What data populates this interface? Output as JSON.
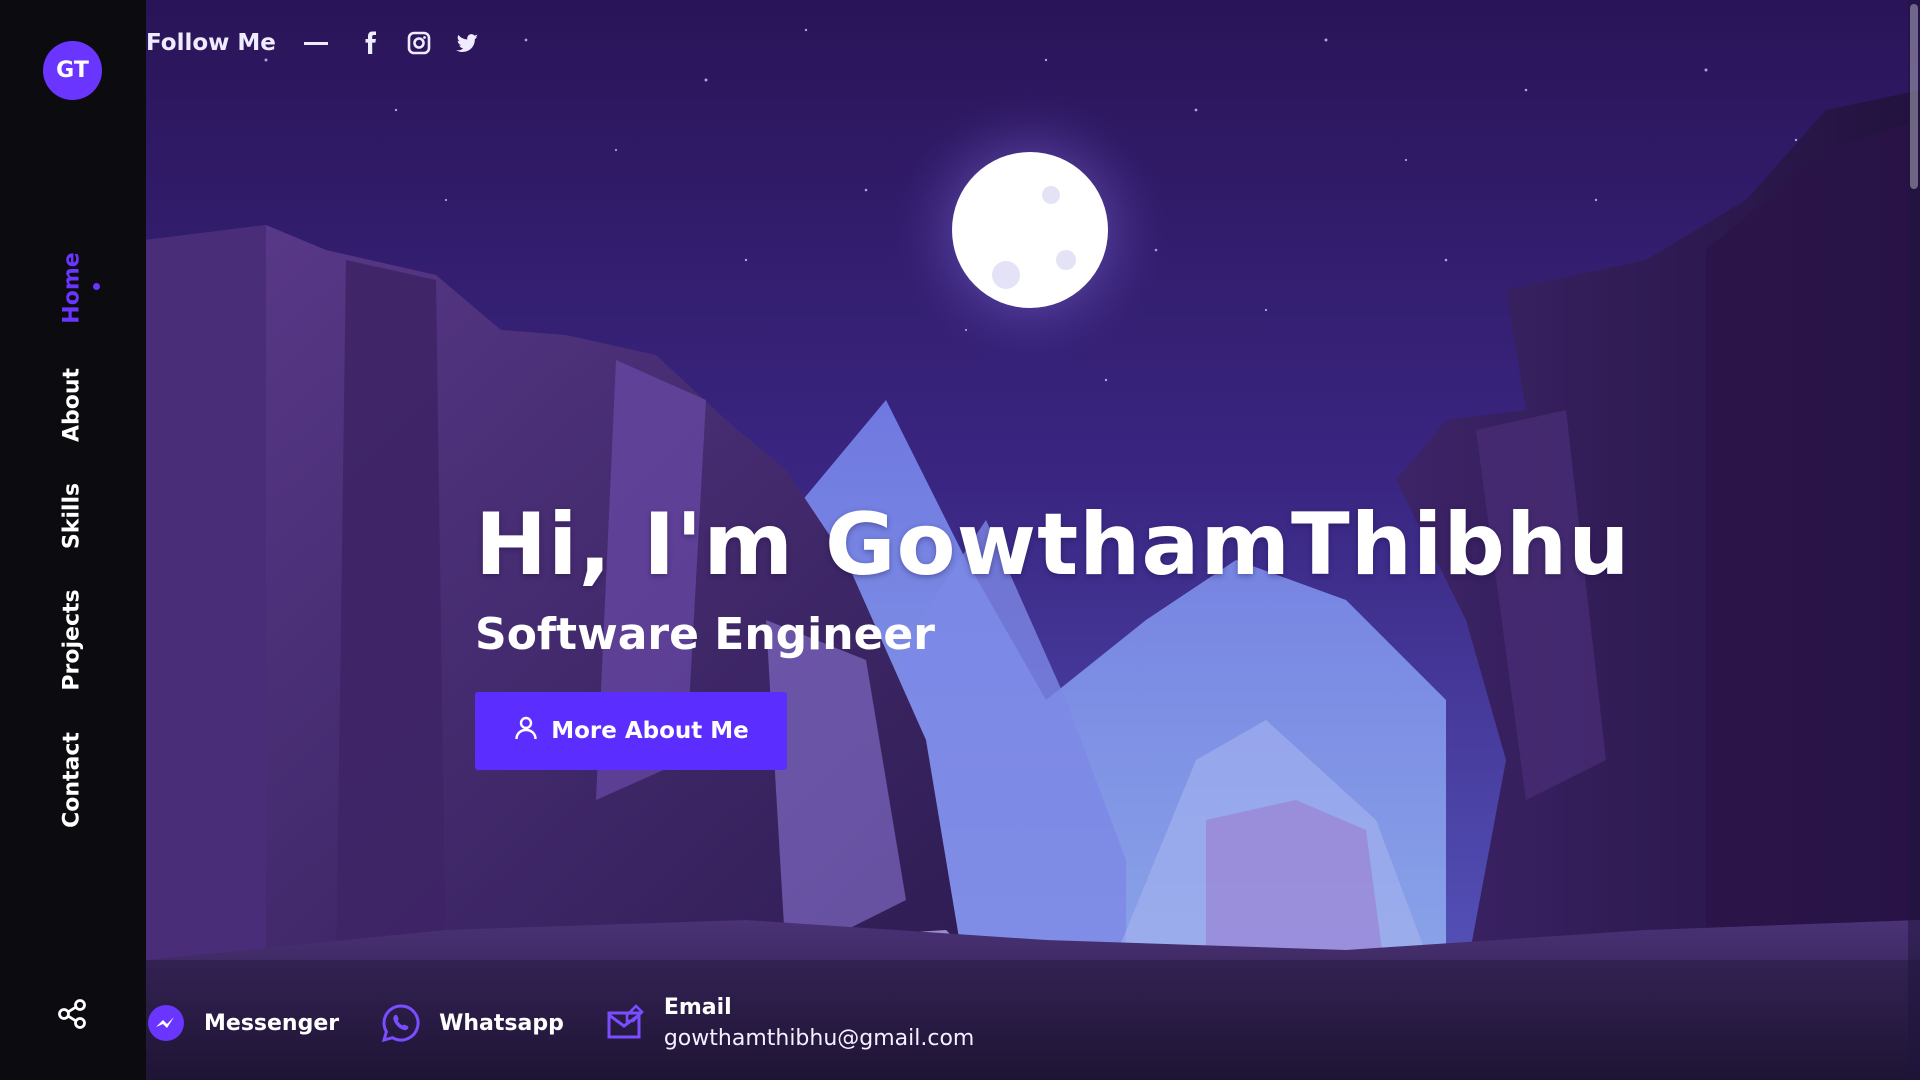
{
  "brand": {
    "initials": "GT"
  },
  "nav": {
    "items": [
      {
        "label": "Home",
        "active": true
      },
      {
        "label": "About",
        "active": false
      },
      {
        "label": "Skills",
        "active": false
      },
      {
        "label": "Projects",
        "active": false
      },
      {
        "label": "Contact",
        "active": false
      }
    ],
    "share_icon": "share-icon"
  },
  "follow": {
    "label": "Follow Me",
    "icons": [
      "facebook-icon",
      "instagram-icon",
      "twitter-icon"
    ]
  },
  "hero": {
    "title": "Hi, I'm GowthamThibhu",
    "subtitle": "Software Engineer",
    "cta_label": "More About Me",
    "cta_icon": "user-icon"
  },
  "contacts": {
    "messenger": {
      "label": "Messenger",
      "icon": "messenger-icon"
    },
    "whatsapp": {
      "label": "Whatsapp",
      "icon": "whatsapp-icon"
    },
    "email": {
      "label": "Email",
      "value": "gowthamthibhu@gmail.com",
      "icon": "email-icon"
    }
  },
  "colors": {
    "accent": "#6a35ff",
    "sidebar_bg": "#0c0b10",
    "sky_top": "#2a1458",
    "sky_bottom": "#4a3aa6",
    "moon": "#ffffff"
  }
}
